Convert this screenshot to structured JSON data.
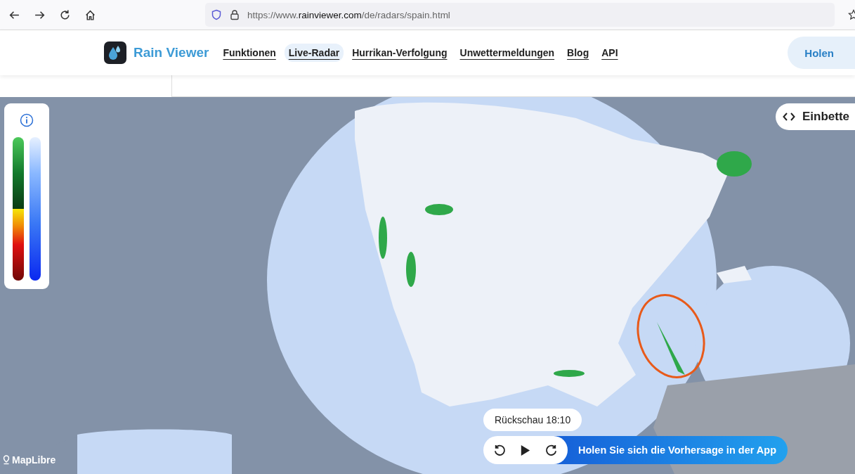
{
  "browser": {
    "url_prefix": "https://www.",
    "url_domain": "rainviewer.com",
    "url_path": "/de/radars/spain.html"
  },
  "site": {
    "brand": "Rain Viewer",
    "nav": [
      {
        "label": "Funktionen",
        "selected": false
      },
      {
        "label": "Live-Radar",
        "selected": true
      },
      {
        "label": "Hurrikan-Verfolgung",
        "selected": false
      },
      {
        "label": "Unwettermeldungen",
        "selected": false
      },
      {
        "label": "Blog",
        "selected": false
      },
      {
        "label": "API",
        "selected": false
      }
    ],
    "cta": "Holen"
  },
  "map": {
    "embed": "Einbette",
    "replay_time": "Rückschau 18:10",
    "app_banner": "Holen Sie sich die Vorhersage in der App",
    "attribution": "MapLibre"
  }
}
